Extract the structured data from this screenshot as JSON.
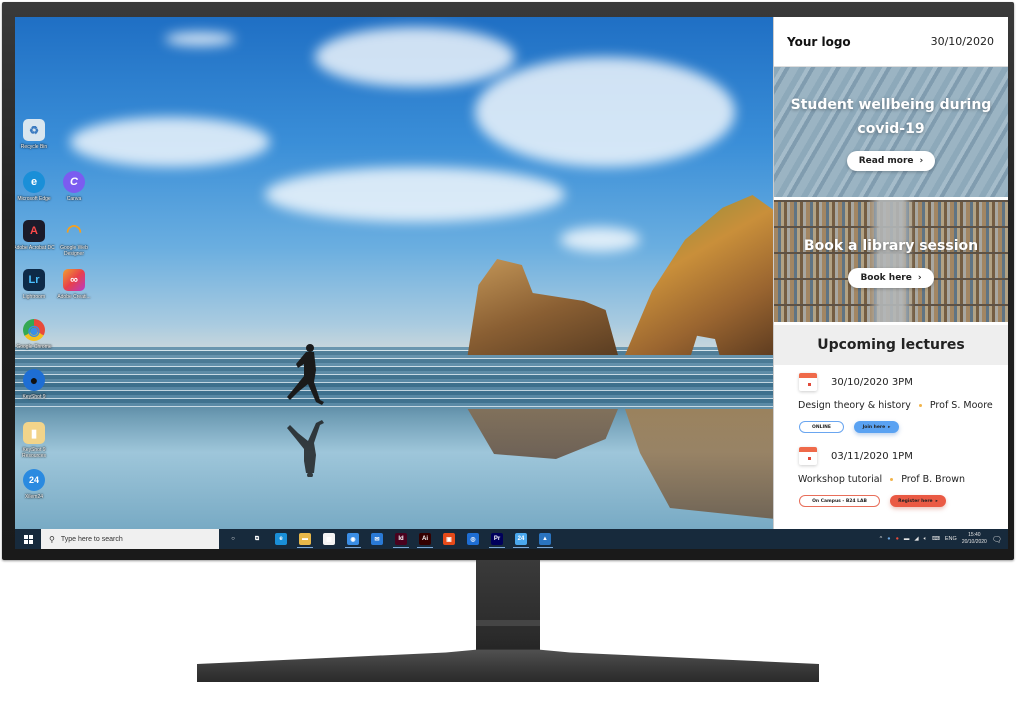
{
  "desktop": {
    "icons": [
      {
        "name": "recycle-bin",
        "label": "Recycle Bin",
        "glyph": "♻",
        "color": "#d9e6ef"
      },
      {
        "name": "microsoft-edge",
        "label": "Microsoft Edge",
        "glyph": "e",
        "color": "#1a8fd8"
      },
      {
        "name": "canva",
        "label": "Canva",
        "glyph": "C",
        "color": "#7b5cf0"
      },
      {
        "name": "adobe-acrobat",
        "label": "Adobe Acrobat DC",
        "glyph": "A",
        "color": "#1b1b2a"
      },
      {
        "name": "google-web-designer",
        "label": "Google Web Designer",
        "glyph": "◠",
        "color": "#f4a020"
      },
      {
        "name": "lightroom",
        "label": "Lightroom",
        "glyph": "Lr",
        "color": "#0e2a48"
      },
      {
        "name": "adobe-creative-cloud",
        "label": "Adobe Creati...",
        "glyph": "∞",
        "color": "#e8404a"
      },
      {
        "name": "google-chrome",
        "label": "Google Chrome",
        "glyph": "◉",
        "color": "#3a8ee6"
      },
      {
        "name": "keyshot",
        "label": "KeyShot 9",
        "glyph": "●",
        "color": "#1e6ed4"
      },
      {
        "name": "keyshot-resources",
        "label": "KeyShot 9 Resources",
        "glyph": "▮",
        "color": "#f2d48a"
      },
      {
        "name": "24-app",
        "label": "Xilem24",
        "glyph": "24",
        "color": "#2a8ae0"
      }
    ]
  },
  "taskbar": {
    "search_placeholder": "Type here to search",
    "apps": [
      {
        "name": "cortana",
        "glyph": "○",
        "color": "transparent",
        "active": false
      },
      {
        "name": "task-view",
        "glyph": "⧉",
        "color": "transparent",
        "active": false
      },
      {
        "name": "edge",
        "glyph": "e",
        "color": "#1a8fd8",
        "active": false
      },
      {
        "name": "file-explorer",
        "glyph": "▬",
        "color": "#e8b84a",
        "active": true
      },
      {
        "name": "microsoft-store",
        "glyph": "▦",
        "color": "#f3f3f3",
        "active": false
      },
      {
        "name": "chrome",
        "glyph": "◉",
        "color": "#3a8ee6",
        "active": true
      },
      {
        "name": "mail",
        "glyph": "✉",
        "color": "#2a7ad6",
        "active": false
      },
      {
        "name": "indesign",
        "glyph": "Id",
        "color": "#49021f",
        "active": true
      },
      {
        "name": "illustrator",
        "glyph": "Ai",
        "color": "#330000",
        "active": true
      },
      {
        "name": "office",
        "glyph": "▣",
        "color": "#e64a19",
        "active": false
      },
      {
        "name": "keyshot",
        "glyph": "◎",
        "color": "#1e6ed4",
        "active": false
      },
      {
        "name": "premiere",
        "glyph": "Pr",
        "color": "#00005b",
        "active": true
      },
      {
        "name": "24-app",
        "glyph": "24",
        "color": "#4aa8ee",
        "active": true
      },
      {
        "name": "photos",
        "glyph": "▲",
        "color": "#2a74c0",
        "active": true
      }
    ],
    "tray": {
      "language": "ENG",
      "time": "15:40",
      "date": "20/10/2020"
    }
  },
  "panel": {
    "logo": "Your logo",
    "date": "30/10/2020",
    "hero_wellbeing": {
      "title": "Student wellbeing during covid-19",
      "button": "Read more"
    },
    "hero_library": {
      "title": "Book a library session",
      "button": "Book here"
    },
    "lectures_title": "Upcoming lectures",
    "lectures": [
      {
        "datetime": "30/10/2020 3PM",
        "title": "Design theory & history",
        "lecturer": "Prof S. Moore",
        "location": "ONLINE",
        "action": "Join here"
      },
      {
        "datetime": "03/11/2020 1PM",
        "title": "Workshop tutorial",
        "lecturer": "Prof B. Brown",
        "location": "On Campus - B24 LAB",
        "action": "Register here"
      }
    ]
  }
}
